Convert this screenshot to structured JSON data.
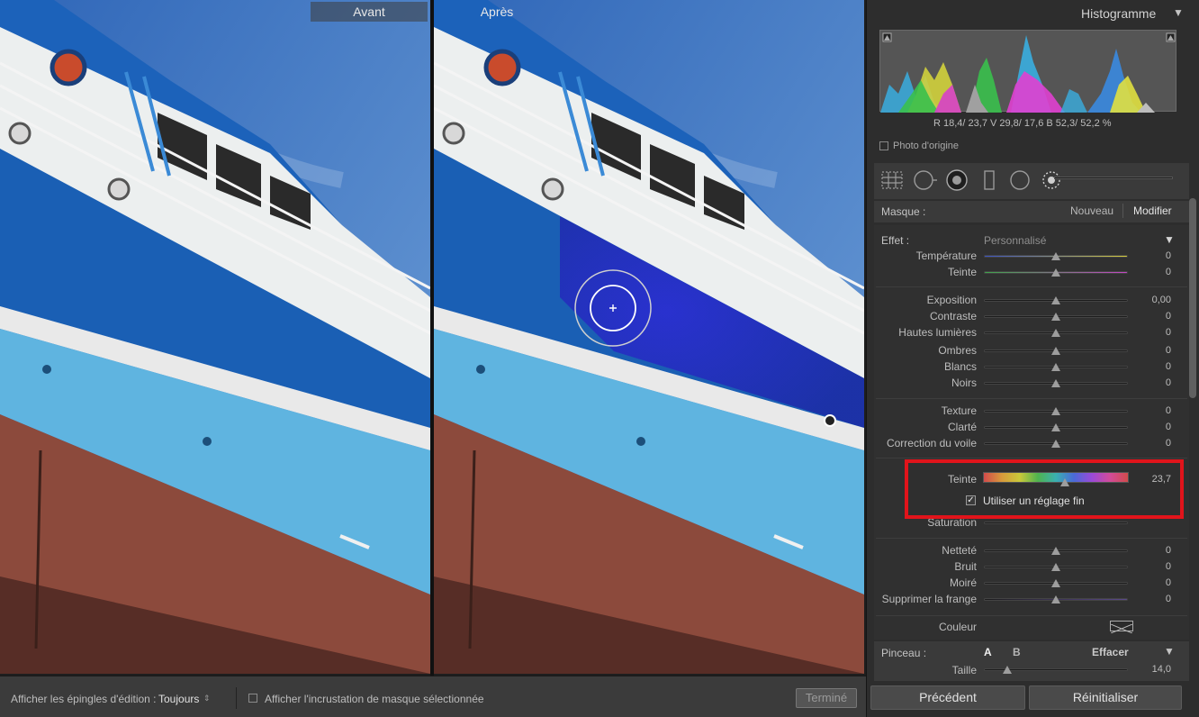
{
  "viewer": {
    "before_label": "Avant",
    "after_label": "Après"
  },
  "toolbar": {
    "pins_label": "Afficher les épingles d'édition :",
    "pins_value": "Toujours",
    "mask_overlay_label": "Afficher l'incrustation de masque sélectionnée",
    "done_button": "Terminé"
  },
  "histogram": {
    "title": "Histogramme",
    "rgb_readout": "R  18,4/ 23,7   V  29,8/ 17,6   B  52,3/ 52,2 %",
    "original_photo_label": "Photo d'origine"
  },
  "mask": {
    "label": "Masque :",
    "new_label": "Nouveau",
    "edit_label": "Modifier"
  },
  "effect": {
    "label": "Effet :",
    "preset": "Personnalisé",
    "sliders": [
      {
        "label": "Température",
        "value": "0"
      },
      {
        "label": "Teinte",
        "value": "0"
      },
      {
        "label": "Exposition",
        "value": "0,00"
      },
      {
        "label": "Contraste",
        "value": "0"
      },
      {
        "label": "Hautes lumières",
        "value": "0"
      },
      {
        "label": "Ombres",
        "value": "0"
      },
      {
        "label": "Blancs",
        "value": "0"
      },
      {
        "label": "Noirs",
        "value": "0"
      },
      {
        "label": "Texture",
        "value": "0"
      },
      {
        "label": "Clarté",
        "value": "0"
      },
      {
        "label": "Correction du voile",
        "value": "0"
      },
      {
        "label": "Netteté",
        "value": "0"
      },
      {
        "label": "Bruit",
        "value": "0"
      },
      {
        "label": "Moiré",
        "value": "0"
      },
      {
        "label": "Supprimer la frange",
        "value": "0"
      }
    ],
    "hue": {
      "label": "Teinte",
      "value": "23,7",
      "fine_label": "Utiliser un réglage fin",
      "fine_checked": true,
      "position": 0.56
    },
    "saturation_label": "Saturation",
    "color_label": "Couleur"
  },
  "brush": {
    "label": "Pinceau :",
    "a": "A",
    "b": "B",
    "erase": "Effacer",
    "size_label": "Taille",
    "size_value": "14,0"
  },
  "buttons": {
    "previous": "Précédent",
    "reset": "Réinitialiser"
  },
  "colors": {
    "highlight": "#e1141b",
    "hull_blue": "#1a5fb4",
    "hull_blue_edited": "#1c2fa6",
    "hull_light": "#5fb4e0",
    "hull_red": "#8c4a3c"
  }
}
